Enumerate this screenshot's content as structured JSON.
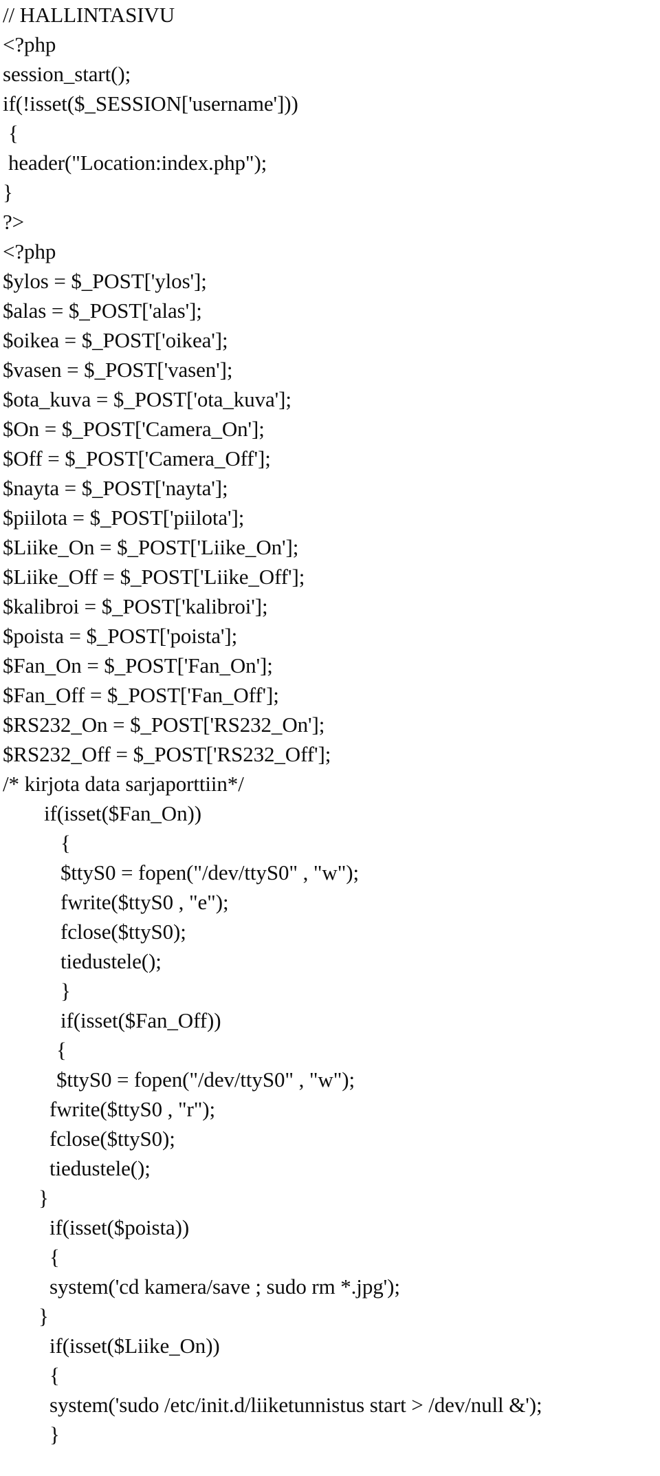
{
  "document": {
    "kind": "plain-text-source-listing",
    "language": "php",
    "background_color": "#ffffff",
    "text_color": "#0d0d0d",
    "lines": [
      {
        "indent": 0,
        "text": "// HALLINTASIVU"
      },
      {
        "indent": 0,
        "text": "<?php"
      },
      {
        "indent": 0,
        "text": "session_start();"
      },
      {
        "indent": 0,
        "text": "if(!isset($_SESSION['username']))"
      },
      {
        "indent": 1,
        "text": "{"
      },
      {
        "indent": 1,
        "text": "header(\"Location:index.php\");"
      },
      {
        "indent": 0,
        "text": "}"
      },
      {
        "indent": 0,
        "text": "?>"
      },
      {
        "indent": 0,
        "text": "<?php"
      },
      {
        "indent": 0,
        "text": "$ylos = $_POST['ylos'];"
      },
      {
        "indent": 0,
        "text": "$alas = $_POST['alas'];"
      },
      {
        "indent": 0,
        "text": "$oikea = $_POST['oikea'];"
      },
      {
        "indent": 0,
        "text": "$vasen = $_POST['vasen'];"
      },
      {
        "indent": 0,
        "text": "$ota_kuva = $_POST['ota_kuva'];"
      },
      {
        "indent": 0,
        "text": "$On = $_POST['Camera_On'];"
      },
      {
        "indent": 0,
        "text": "$Off = $_POST['Camera_Off'];"
      },
      {
        "indent": 0,
        "text": "$nayta = $_POST['nayta'];"
      },
      {
        "indent": 0,
        "text": "$piilota = $_POST['piilota'];"
      },
      {
        "indent": 0,
        "text": "$Liike_On = $_POST['Liike_On'];"
      },
      {
        "indent": 0,
        "text": "$Liike_Off = $_POST['Liike_Off'];"
      },
      {
        "indent": 0,
        "text": "$kalibroi = $_POST['kalibroi'];"
      },
      {
        "indent": 0,
        "text": "$poista = $_POST['poista'];"
      },
      {
        "indent": 0,
        "text": "$Fan_On = $_POST['Fan_On'];"
      },
      {
        "indent": 0,
        "text": "$Fan_Off = $_POST['Fan_Off'];"
      },
      {
        "indent": 0,
        "text": "$RS232_On = $_POST['RS232_On'];"
      },
      {
        "indent": 0,
        "text": "$RS232_Off = $_POST['RS232_Off'];"
      },
      {
        "indent": 0,
        "text": "/* kirjota data sarjaporttiin*/"
      },
      {
        "indent": 2,
        "text": "if(isset($Fan_On))"
      },
      {
        "indent": 3,
        "text": "{"
      },
      {
        "indent": 3,
        "text": "$ttyS0 = fopen(\"/dev/ttyS0\" , \"w\");"
      },
      {
        "indent": 3,
        "text": "fwrite($ttyS0 , \"e\");"
      },
      {
        "indent": 3,
        "text": "fclose($ttyS0);"
      },
      {
        "indent": 3,
        "text": "tiedustele();"
      },
      {
        "indent": 3,
        "text": "}"
      },
      {
        "indent": 3,
        "text": "if(isset($Fan_Off))"
      },
      {
        "indent": 4,
        "text": "{"
      },
      {
        "indent": 4,
        "text": "$ttyS0 = fopen(\"/dev/ttyS0\" , \"w\");"
      },
      {
        "indent": 5,
        "text": "fwrite($ttyS0 , \"r\");"
      },
      {
        "indent": 5,
        "text": "fclose($ttyS0);"
      },
      {
        "indent": 5,
        "text": "tiedustele();"
      },
      {
        "indent": 6,
        "text": "}"
      },
      {
        "indent": 5,
        "text": "if(isset($poista))"
      },
      {
        "indent": 5,
        "text": "{"
      },
      {
        "indent": 5,
        "text": "system('cd kamera/save ; sudo rm *.jpg');"
      },
      {
        "indent": 6,
        "text": "}"
      },
      {
        "indent": 5,
        "text": "if(isset($Liike_On))"
      },
      {
        "indent": 5,
        "text": "{"
      },
      {
        "indent": 5,
        "text": "system('sudo /etc/init.d/liiketunnistus start > /dev/null &');"
      },
      {
        "indent": 5,
        "text": "}"
      }
    ]
  }
}
